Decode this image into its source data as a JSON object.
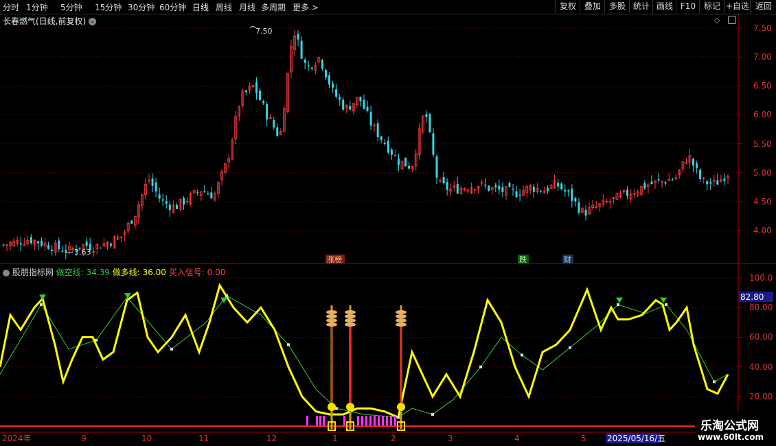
{
  "toolbar": {
    "periods": [
      "分时",
      "1分钟",
      "5分钟",
      "15分钟",
      "30分钟",
      "60分钟",
      "日线",
      "周线",
      "月线",
      "多周期",
      "更多 >"
    ],
    "active_period": "日线",
    "buttons": [
      "复权",
      "叠加",
      "多股",
      "统计",
      "画线",
      "F10",
      "标记",
      "+自选",
      "返回"
    ]
  },
  "main_chart": {
    "title": "长春燃气(日线,前复权)",
    "high_label": "7.50",
    "low_label": "3.63",
    "y_ticks": [
      "7.50",
      "7.00",
      "6.50",
      "6.00",
      "5.50",
      "5.00",
      "4.50",
      "4.00"
    ],
    "event_tags": [
      "涨榜",
      "跌",
      "财"
    ]
  },
  "indicator": {
    "name": "股朋指标网",
    "short_line_label": "做空线: 34.39",
    "long_line_label": "做多线: 36.00",
    "buy_signal_label": "买入信号: 0.00",
    "y_ticks": [
      "100.0",
      "80.00",
      "60.00",
      "40.00",
      "20.00"
    ],
    "current_value": "82.80"
  },
  "time_axis": {
    "labels": [
      "2024年",
      "9",
      "10",
      "11",
      "12",
      "1",
      "2",
      "3",
      "4",
      "5"
    ],
    "cursor_date": "2025/05/16/五"
  },
  "watermark": {
    "title": "乐淘公式网",
    "url": "www.60lt.com"
  },
  "chart_data": {
    "type": "candlestick",
    "y_range": [
      3.6,
      7.6
    ],
    "close_approx": [
      3.75,
      3.8,
      3.85,
      3.78,
      3.7,
      3.65,
      3.75,
      3.72,
      3.8,
      3.9,
      4.3,
      4.9,
      4.5,
      4.4,
      4.55,
      4.7,
      4.6,
      5.2,
      6.3,
      6.5,
      6.0,
      5.6,
      7.5,
      6.8,
      7.0,
      6.4,
      6.1,
      6.3,
      5.8,
      5.5,
      5.2,
      5.1,
      6.1,
      4.8,
      4.7,
      4.75,
      4.8,
      4.72,
      4.68,
      4.65,
      4.75,
      4.7,
      4.8,
      4.6,
      4.3,
      4.4,
      4.5,
      4.6,
      4.7,
      4.8,
      4.85,
      4.9,
      5.3,
      4.85,
      4.8,
      5.0
    ],
    "indicator_range": [
      0,
      100
    ],
    "short_line_value": 34.39,
    "long_line_value": 36.0,
    "buy_signal_value": 0.0
  }
}
